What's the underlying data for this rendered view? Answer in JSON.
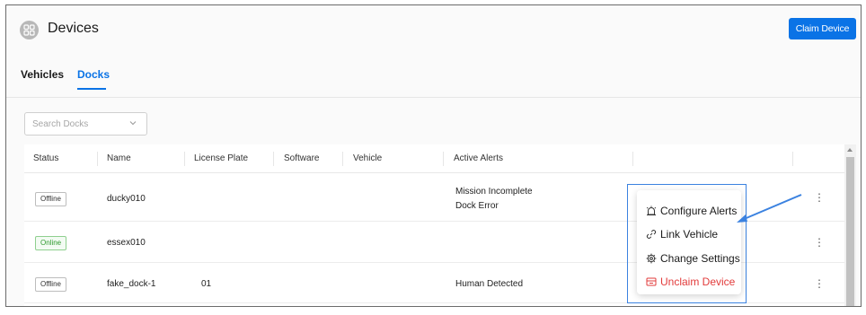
{
  "header": {
    "title": "Devices",
    "icon": "devices-icon",
    "claim_button": "Claim Device"
  },
  "tabs": [
    {
      "label": "Vehicles",
      "active": false
    },
    {
      "label": "Docks",
      "active": true
    }
  ],
  "search": {
    "placeholder": "Search Docks",
    "value": ""
  },
  "table": {
    "columns": [
      "Status",
      "Name",
      "License Plate",
      "Software",
      "Vehicle",
      "Active Alerts"
    ],
    "rows": [
      {
        "status": "Offline",
        "name": "ducky010",
        "license_plate": "",
        "software": "",
        "vehicle": "",
        "alerts": [
          "Mission Incomplete",
          "Dock Error"
        ]
      },
      {
        "status": "Online",
        "name": "essex010",
        "license_plate": "",
        "software": "",
        "vehicle": "",
        "alerts": []
      },
      {
        "status": "Offline",
        "name": "fake_dock-1",
        "license_plate": "01",
        "software": "",
        "vehicle": "",
        "alerts": [
          "Human Detected"
        ]
      }
    ]
  },
  "context_menu": {
    "items": [
      {
        "label": "Configure Alerts",
        "icon": "alarm-icon"
      },
      {
        "label": "Link Vehicle",
        "icon": "link-icon"
      },
      {
        "label": "Change Settings",
        "icon": "gear-icon"
      },
      {
        "label": "Unclaim Device",
        "icon": "unclaim-icon",
        "danger": true
      }
    ]
  },
  "colors": {
    "accent": "#0a73e6",
    "online": "#2e9a2e",
    "danger": "#e23b3b",
    "annotation": "#3b82e0"
  }
}
